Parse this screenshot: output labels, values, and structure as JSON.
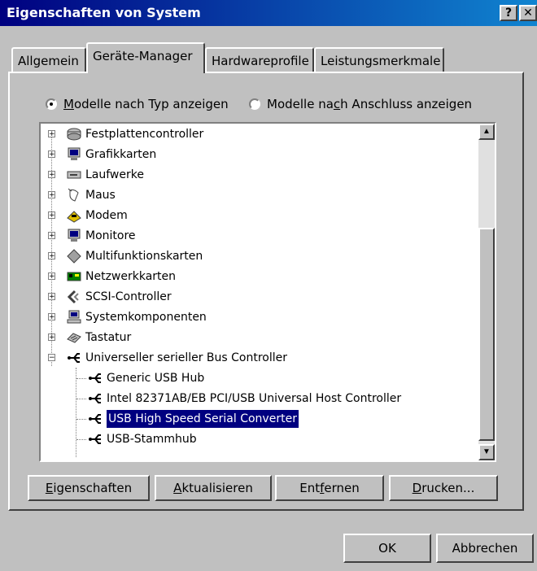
{
  "window": {
    "title": "Eigenschaften von System",
    "help_label": "?",
    "close_label": "✕"
  },
  "tabs": [
    {
      "label": "Allgemein",
      "active": false
    },
    {
      "label": "Geräte-Manager",
      "active": true
    },
    {
      "label": "Hardwareprofile",
      "active": false
    },
    {
      "label": "Leistungsmerkmale",
      "active": false
    }
  ],
  "view_options": {
    "by_type": {
      "mnemonic": "M",
      "rest": "odelle nach Typ anzeigen",
      "selected": true
    },
    "by_connection": {
      "pre": "Modelle na",
      "mnemonic": "c",
      "rest": "h Anschluss anzeigen",
      "selected": false
    }
  },
  "tree": {
    "items": [
      {
        "label": "Festplattencontroller",
        "icon": "disk-controller-icon",
        "expander": "+"
      },
      {
        "label": "Grafikkarten",
        "icon": "monitor-icon",
        "expander": "+"
      },
      {
        "label": "Laufwerke",
        "icon": "drive-icon",
        "expander": "+"
      },
      {
        "label": "Maus",
        "icon": "mouse-icon",
        "expander": "+"
      },
      {
        "label": "Modem",
        "icon": "modem-icon",
        "expander": "+"
      },
      {
        "label": "Monitore",
        "icon": "monitor-icon",
        "expander": "+"
      },
      {
        "label": "Multifunktionskarten",
        "icon": "multifunction-icon",
        "expander": "+"
      },
      {
        "label": "Netzwerkkarten",
        "icon": "network-card-icon",
        "expander": "+"
      },
      {
        "label": "SCSI-Controller",
        "icon": "scsi-icon",
        "expander": "+"
      },
      {
        "label": "Systemkomponenten",
        "icon": "computer-icon",
        "expander": "+"
      },
      {
        "label": "Tastatur",
        "icon": "keyboard-icon",
        "expander": "+"
      },
      {
        "label": "Universeller serieller Bus Controller",
        "icon": "usb-icon",
        "expander": "−"
      }
    ],
    "children": [
      {
        "label": "Generic USB Hub",
        "icon": "usb-icon",
        "selected": false
      },
      {
        "label": "Intel 82371AB/EB PCI/USB Universal Host Controller",
        "icon": "usb-icon",
        "selected": false
      },
      {
        "label": "USB High Speed Serial Converter",
        "icon": "usb-icon",
        "selected": true
      },
      {
        "label": "USB-Stammhub",
        "icon": "usb-icon",
        "selected": false
      }
    ]
  },
  "actions": {
    "properties": {
      "mnemonic": "E",
      "rest": "igenschaften"
    },
    "refresh": {
      "mnemonic": "A",
      "rest": "ktualisieren"
    },
    "remove": {
      "pre": "Ent",
      "mnemonic": "f",
      "rest": "ernen"
    },
    "print": {
      "mnemonic": "D",
      "rest": "rucken..."
    }
  },
  "dialog_buttons": {
    "ok": "OK",
    "cancel": "Abbrechen"
  },
  "colors": {
    "title_bar": "#000080",
    "selection": "#000080",
    "face": "#c0c0c0"
  }
}
